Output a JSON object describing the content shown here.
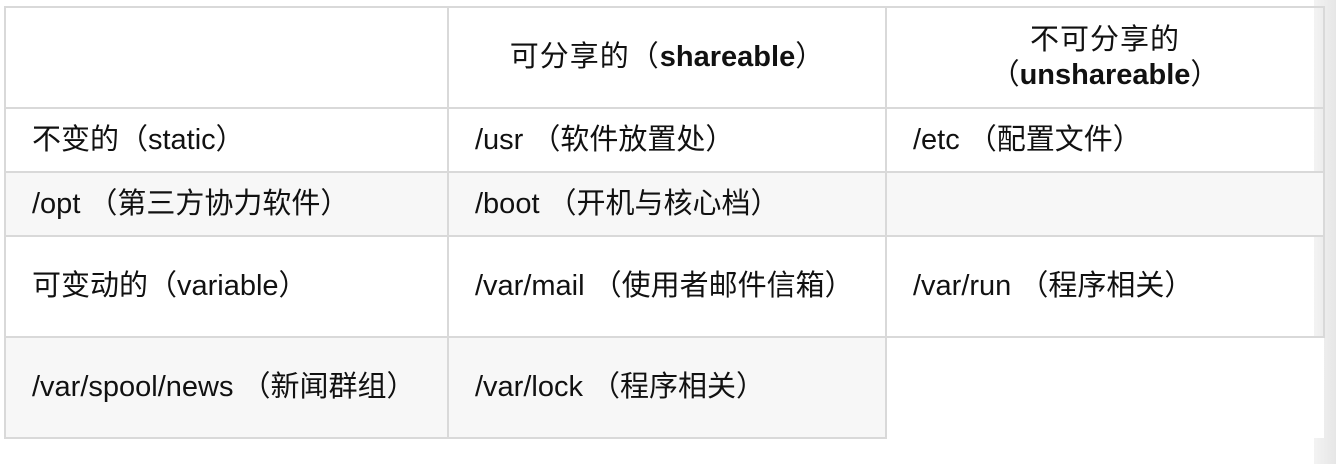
{
  "table": {
    "header": {
      "corner": "",
      "shareable_cjk": "可分享的（",
      "shareable_en": "shareable",
      "shareable_close": "）",
      "unshareable_cjk": "不可分享的",
      "unshareable_open": "（",
      "unshareable_en": "unshareable",
      "unshareable_close": "）"
    },
    "rows": [
      {
        "label": "不变的（static）",
        "shareable": "/usr （软件放置处）",
        "unshareable": "/etc （配置文件）"
      },
      {
        "label": "/opt （第三方协力软件）",
        "shareable": "/boot （开机与核心档）",
        "unshareable": ""
      },
      {
        "label": "可变动的（variable）",
        "shareable": "/var/mail （使用者邮件信箱）",
        "unshareable": "/var/run （程序相关）"
      },
      {
        "label": "/var/spool/news （新闻群组）",
        "shareable": "/var/lock （程序相关）",
        "unshareable": ""
      }
    ]
  }
}
